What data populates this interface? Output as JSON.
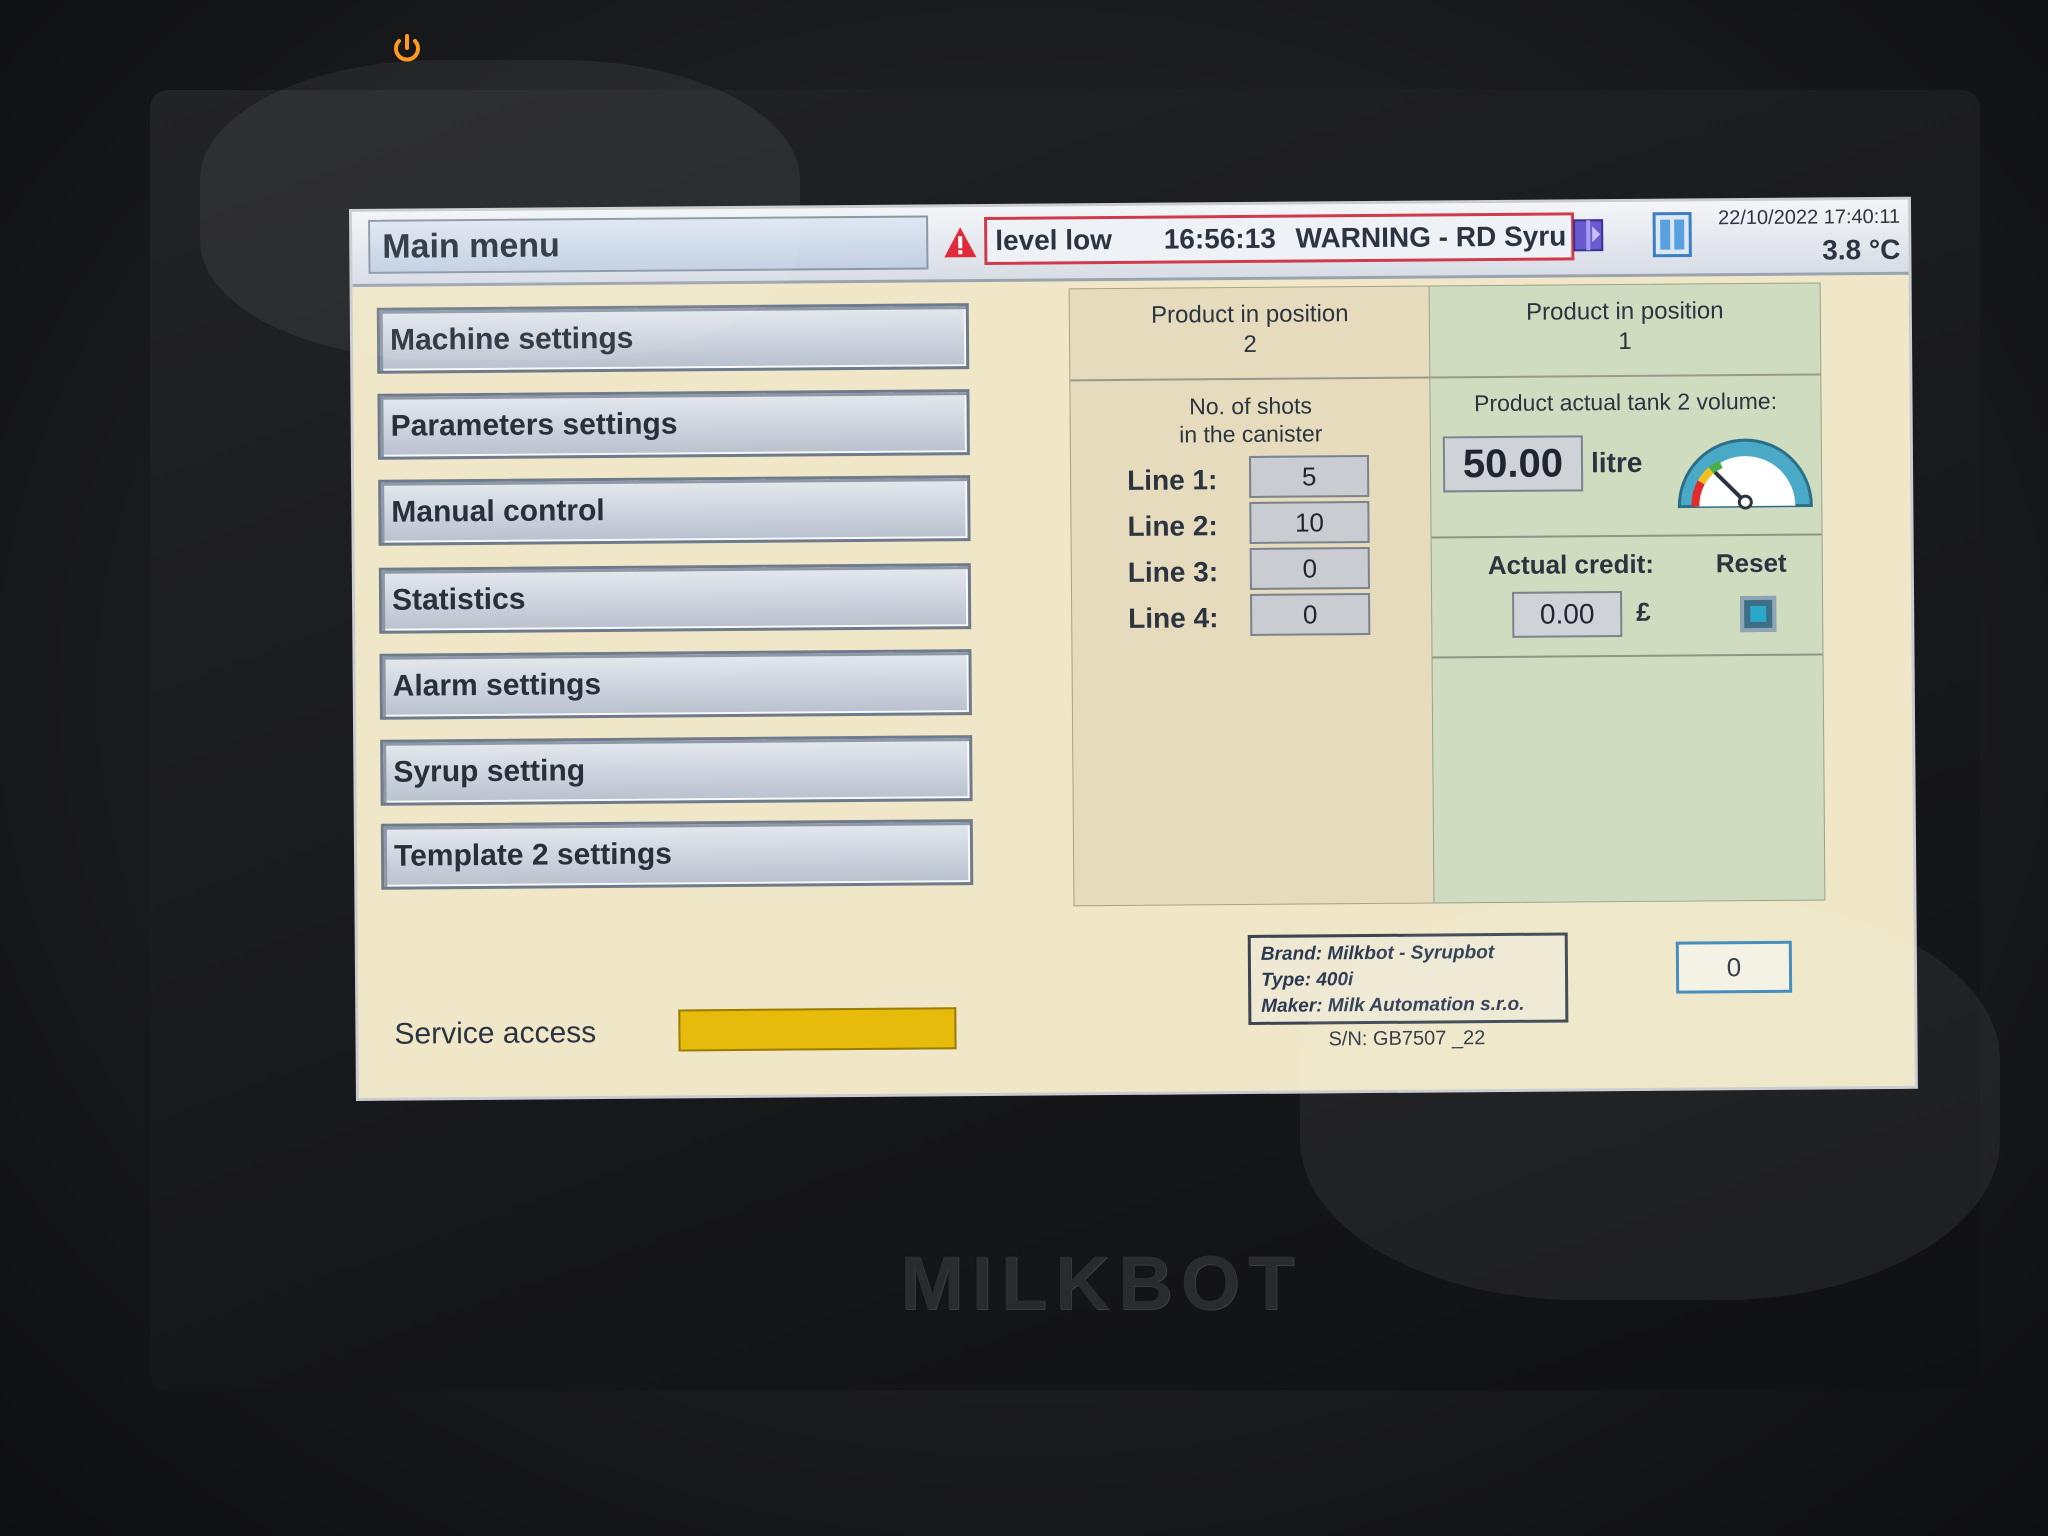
{
  "device": {
    "emboss": "MILKBOT"
  },
  "header": {
    "title": "Main menu",
    "alarm": {
      "message": "level low",
      "time": "16:56:13",
      "severity": "WARNING - RD Syru"
    },
    "datetime": "22/10/2022 17:40:11",
    "temperature": "3.8 °C"
  },
  "menu": {
    "items": [
      {
        "label": "Machine settings"
      },
      {
        "label": "Parameters settings"
      },
      {
        "label": "Manual control"
      },
      {
        "label": "Statistics"
      },
      {
        "label": "Alarm settings"
      },
      {
        "label": "Syrup setting"
      },
      {
        "label": "Template 2 settings"
      }
    ],
    "service_access_label": "Service access"
  },
  "product_left": {
    "title_line1": "Product in position",
    "title_line2": "2",
    "shots_title_line1": "No. of shots",
    "shots_title_line2": "in the canister",
    "lines": [
      {
        "label": "Line 1:",
        "value": "5"
      },
      {
        "label": "Line 2:",
        "value": "10"
      },
      {
        "label": "Line 3:",
        "value": "0"
      },
      {
        "label": "Line 4:",
        "value": "0"
      }
    ]
  },
  "product_right": {
    "title_line1": "Product in position",
    "title_line2": "1",
    "volume_title": "Product actual tank 2 volume:",
    "volume_value": "50.00",
    "volume_unit": "litre",
    "credit_title": "Actual credit:",
    "reset_label": "Reset",
    "credit_value": "0.00",
    "credit_unit": "£"
  },
  "info": {
    "brand": "Brand: Milkbot - Syrupbot",
    "type": "Type:  400i",
    "maker": "Maker: Milk Automation s.r.o.",
    "serial": "S/N: GB7507 _22"
  },
  "counter_value": "0",
  "colors": {
    "alarm_border": "#d03a4a",
    "service_bar": "#e7bb0b",
    "left_panel": "#e6dcbd",
    "right_panel": "#cfdcc0",
    "counter_border": "#3d86b8"
  }
}
